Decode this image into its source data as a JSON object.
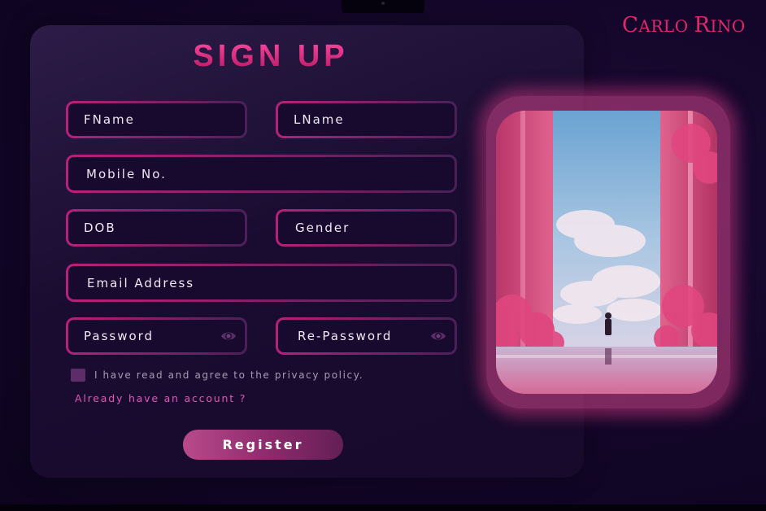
{
  "brand": {
    "text_a": "C",
    "text_b": "ARLO ",
    "text_c": "R",
    "text_d": "INO"
  },
  "form": {
    "title": "SIGN UP",
    "fields": {
      "fname": "FName",
      "lname": "LName",
      "mobile": "Mobile No.",
      "dob": "DOB",
      "gender": "Gender",
      "email": "Email Address",
      "password": "Password",
      "repassword": "Re-Password"
    },
    "agree_text": "I have read and agree to the privacy policy.",
    "already_text": "Already have an account ?",
    "register_label": "Register"
  },
  "icons": {
    "password_eye": "eye-icon",
    "repassword_eye": "eye-icon",
    "logo": "brand-wordmark"
  },
  "colors": {
    "accent": "#e2286a",
    "field_border": "#b21a72",
    "background": "#130628",
    "card": "#1f1036"
  }
}
